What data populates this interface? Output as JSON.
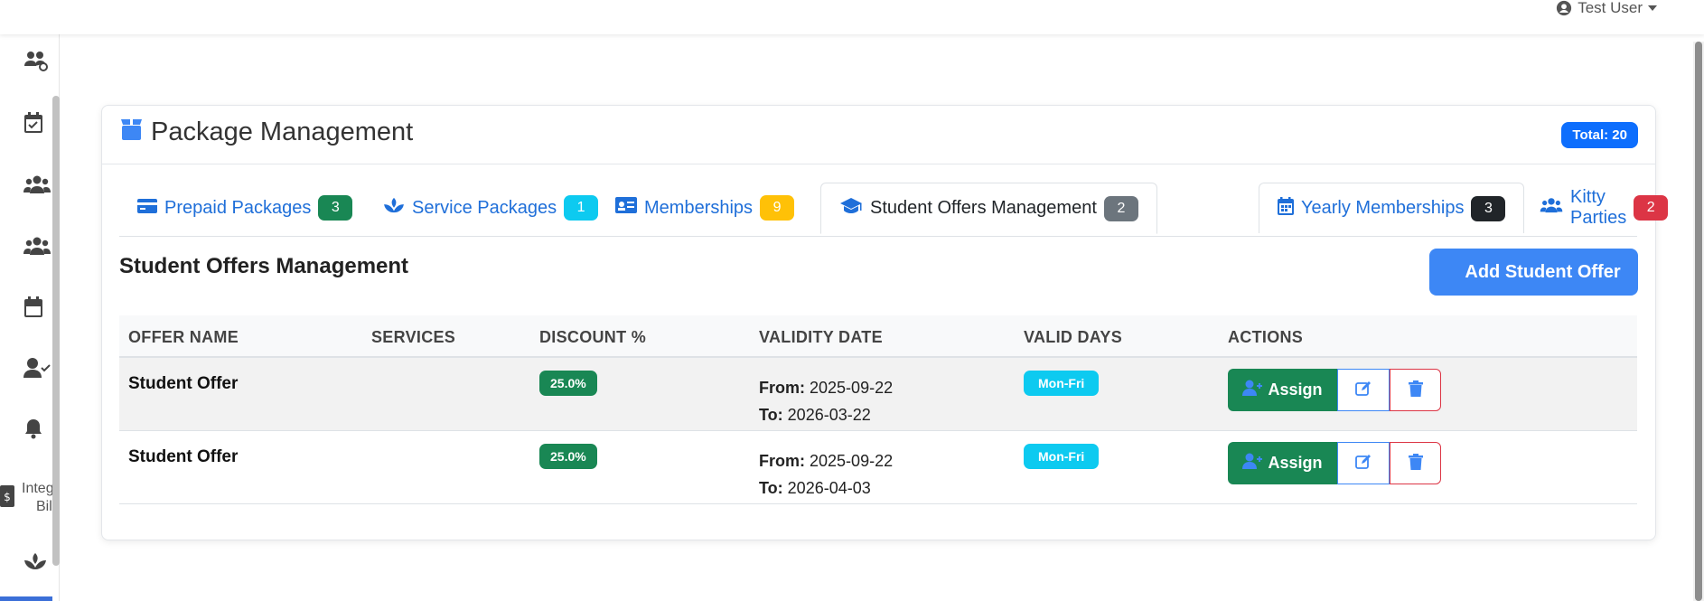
{
  "header": {
    "user_name": "Test User"
  },
  "sidebar": {
    "items": [
      {
        "icon": "users-cog-icon"
      },
      {
        "icon": "calendar-check-icon"
      },
      {
        "icon": "users-icon"
      },
      {
        "icon": "users-icon"
      },
      {
        "icon": "calendar-icon"
      },
      {
        "icon": "user-check-icon"
      },
      {
        "icon": "bell-icon"
      },
      {
        "icon": "billing-icon",
        "label_line1": "Integ",
        "label_line2": "Bil"
      },
      {
        "icon": "spa-icon"
      }
    ]
  },
  "card": {
    "title": "Package Management",
    "total_badge": "Total: 20"
  },
  "tabs": [
    {
      "label": "Prepaid Packages",
      "count": "3",
      "icon": "credit-card-icon",
      "color": "#198754"
    },
    {
      "label": "Service Packages",
      "count": "1",
      "icon": "spa-icon",
      "color": "#0dcaf0"
    },
    {
      "label": "Memberships",
      "count": "9",
      "icon": "id-card-icon",
      "color": "#ffc107"
    },
    {
      "label": "Student Offers Management",
      "count": "2",
      "icon": "graduation-cap-icon",
      "color": "#6c757d",
      "active": true
    },
    {
      "label": "Yearly Memberships",
      "count": "3",
      "icon": "calendar-icon",
      "color": "#212529"
    },
    {
      "label": "Kitty Parties",
      "count": "2",
      "icon": "users-icon",
      "color": "#dc3545"
    }
  ],
  "section": {
    "title": "Student Offers Management",
    "add_button": "Add Student Offer"
  },
  "table": {
    "columns": [
      "OFFER NAME",
      "SERVICES",
      "DISCOUNT %",
      "VALIDITY DATE",
      "VALID DAYS",
      "ACTIONS"
    ],
    "from_label": "From:",
    "to_label": "To:",
    "assign_label": "Assign",
    "rows": [
      {
        "name": "Student Offer",
        "services": "",
        "discount": "25.0%",
        "from": "2025-09-22",
        "to": "2026-03-22",
        "days": "Mon-Fri"
      },
      {
        "name": "Student Offer",
        "services": "",
        "discount": "25.0%",
        "from": "2025-09-22",
        "to": "2026-04-03",
        "days": "Mon-Fri"
      }
    ]
  },
  "colors": {
    "primary": "#3d87f5",
    "success": "#198754",
    "info": "#0dcaf0",
    "danger": "#dc3545"
  }
}
